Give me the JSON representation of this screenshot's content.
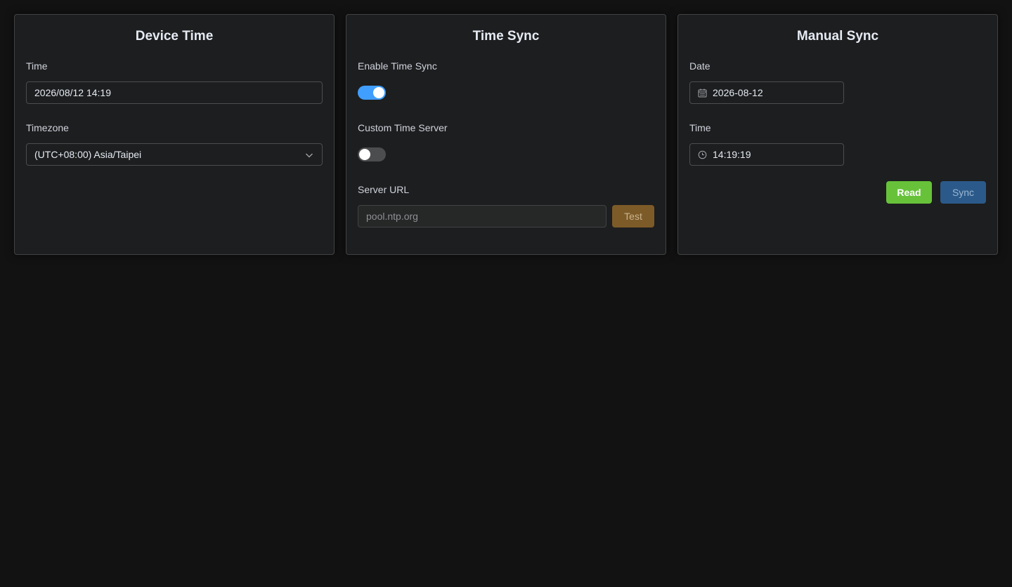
{
  "device_time": {
    "title": "Device Time",
    "time_label": "Time",
    "time_value": "2026/08/12 14:19",
    "timezone_label": "Timezone",
    "timezone_value": "(UTC+08:00) Asia/Taipei"
  },
  "time_sync": {
    "title": "Time Sync",
    "enable_label": "Enable Time Sync",
    "enable_on": true,
    "custom_label": "Custom Time Server",
    "custom_on": false,
    "server_label": "Server URL",
    "server_placeholder": "pool.ntp.org",
    "test_label": "Test"
  },
  "manual_sync": {
    "title": "Manual Sync",
    "date_label": "Date",
    "date_value": "2026-08-12",
    "time_label": "Time",
    "time_value": "14:19:19",
    "read_label": "Read",
    "sync_label": "Sync"
  },
  "colors": {
    "background": "#121212",
    "panel": "#1d1e1f",
    "switch_on": "#409eff",
    "read_button": "#67c23a",
    "sync_button": "#2b5a8a",
    "test_button": "#7d5b28"
  }
}
